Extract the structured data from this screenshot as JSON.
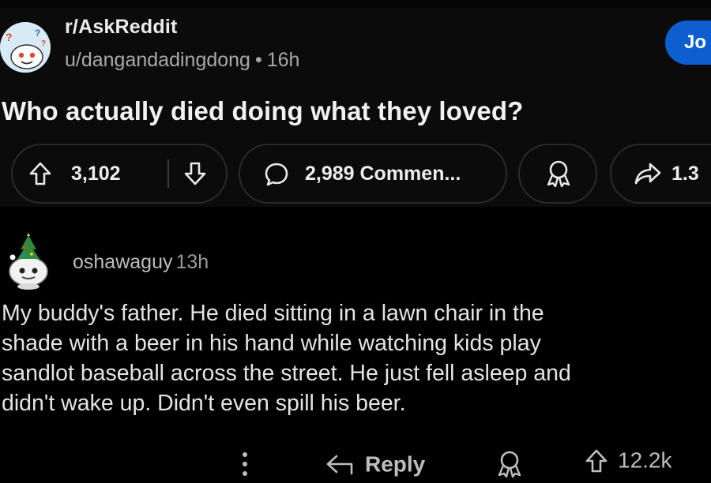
{
  "post": {
    "subreddit": "r/AskReddit",
    "author": "u/dangandadingdong",
    "separator": "•",
    "age": "16h",
    "join_label": "Jo",
    "title": "Who actually died doing what they loved?",
    "upvotes": "3,102",
    "comments_label": "2,989 Commen...",
    "share_label": "1.3"
  },
  "comment": {
    "author": "oshawaguy",
    "age": "13h",
    "body_lines": [
      "My buddy's father.  He died sitting in a lawn chair in the",
      "shade with a beer in his hand while watching kids play",
      "sandlot baseball across the street.  He just fell asleep and",
      "didn't wake up.  Didn't even spill his beer."
    ],
    "reply_label": "Reply",
    "upvotes": "12.2k"
  },
  "icons": {
    "subreddit_avatar": "askreddit-snoo-icon",
    "upvote": "arrow-up-icon",
    "downvote": "arrow-down-icon",
    "comments": "speech-bubble-icon",
    "award": "award-ribbon-icon",
    "share": "share-arrow-icon",
    "more": "more-vertical-icon",
    "reply": "reply-arrow-icon"
  },
  "colors": {
    "background": "#000000",
    "post_background": "#0b0b0b",
    "join_button": "#0d5fd0",
    "pill_border": "#2a2a2a",
    "meta_text": "#a9a9a9"
  }
}
